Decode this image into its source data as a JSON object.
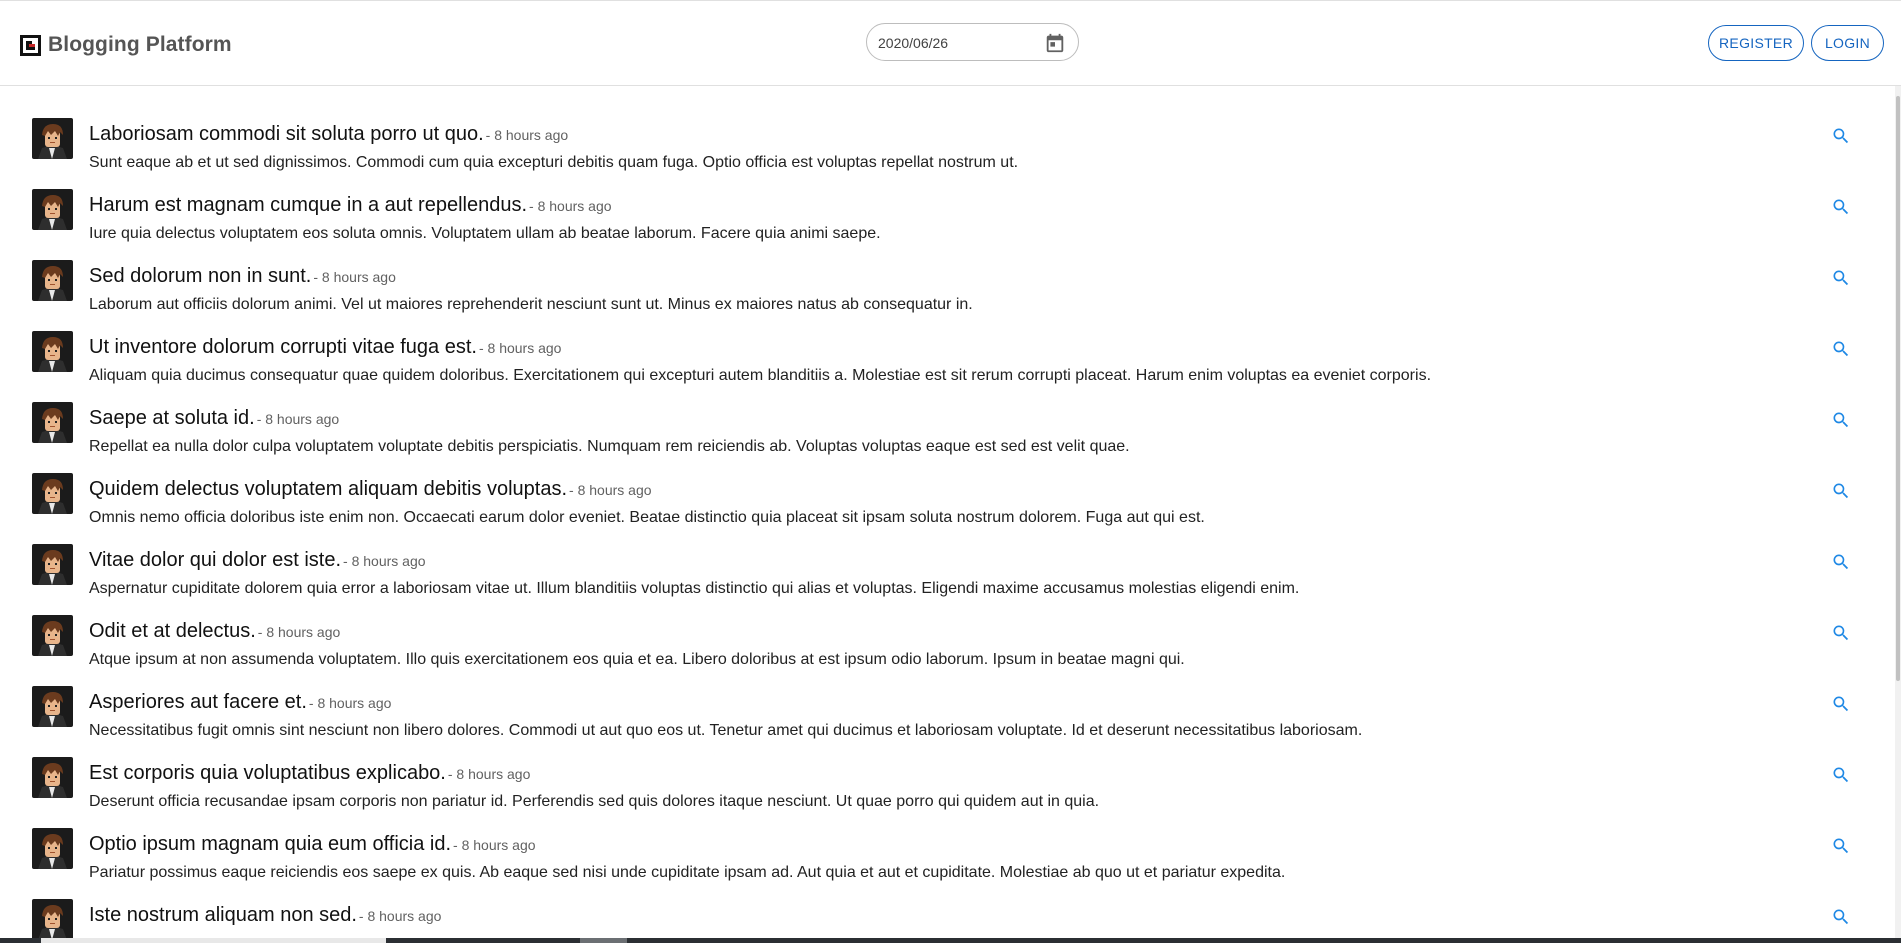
{
  "header": {
    "app_title": "Blogging Platform",
    "logo_icon": "blog-logo-icon",
    "date_value": "2020/06/26",
    "calendar_icon": "calendar-icon",
    "register_label": "REGISTER",
    "login_label": "LOGIN",
    "accent_color": "#1565c0"
  },
  "posts": [
    {
      "title": "Laboriosam commodi sit soluta porro ut quo.",
      "time": "- 8 hours ago",
      "body": "Sunt eaque ab et ut sed dignissimos. Commodi cum quia excepturi debitis quam fuga. Optio officia est voluptas repellat nostrum ut."
    },
    {
      "title": "Harum est magnam cumque in a aut repellendus.",
      "time": "- 8 hours ago",
      "body": "Iure quia delectus voluptatem eos soluta omnis. Voluptatem ullam ab beatae laborum. Facere quia animi saepe."
    },
    {
      "title": "Sed dolorum non in sunt.",
      "time": "- 8 hours ago",
      "body": "Laborum aut officiis dolorum animi. Vel ut maiores reprehenderit nesciunt sunt ut. Minus ex maiores natus ab consequatur in."
    },
    {
      "title": "Ut inventore dolorum corrupti vitae fuga est.",
      "time": "- 8 hours ago",
      "body": "Aliquam quia ducimus consequatur quae quidem doloribus. Exercitationem qui excepturi autem blanditiis a. Molestiae est sit rerum corrupti placeat. Harum enim voluptas ea eveniet corporis."
    },
    {
      "title": "Saepe at soluta id.",
      "time": "- 8 hours ago",
      "body": "Repellat ea nulla dolor culpa voluptatem voluptate debitis perspiciatis. Numquam rem reiciendis ab. Voluptas voluptas eaque est sed est velit quae."
    },
    {
      "title": "Quidem delectus voluptatem aliquam debitis voluptas.",
      "time": "- 8 hours ago",
      "body": "Omnis nemo officia doloribus iste enim non. Occaecati earum dolor eveniet. Beatae distinctio quia placeat sit ipsam soluta nostrum dolorem. Fuga aut qui est."
    },
    {
      "title": "Vitae dolor qui dolor est iste.",
      "time": "- 8 hours ago",
      "body": "Aspernatur cupiditate dolorem quia error a laboriosam vitae ut. Illum blanditiis voluptas distinctio qui alias et voluptas. Eligendi maxime accusamus molestias eligendi enim."
    },
    {
      "title": "Odit et at delectus.",
      "time": "- 8 hours ago",
      "body": "Atque ipsum at non assumenda voluptatem. Illo quis exercitationem eos quia et ea. Libero doloribus at est ipsum odio laborum. Ipsum in beatae magni qui."
    },
    {
      "title": "Asperiores aut facere et.",
      "time": "- 8 hours ago",
      "body": "Necessitatibus fugit omnis sint nesciunt non libero dolores. Commodi ut aut quo eos ut. Tenetur amet qui ducimus et laboriosam voluptate. Id et deserunt necessitatibus laboriosam."
    },
    {
      "title": "Est corporis quia voluptatibus explicabo.",
      "time": "- 8 hours ago",
      "body": "Deserunt officia recusandae ipsam corporis non pariatur id. Perferendis sed quis dolores itaque nesciunt. Ut quae porro qui quidem aut in quia."
    },
    {
      "title": "Optio ipsum magnam quia eum officia id.",
      "time": "- 8 hours ago",
      "body": "Pariatur possimus eaque reiciendis eos saepe ex quis. Ab eaque sed nisi unde cupiditate ipsam ad. Aut quia et aut et cupiditate. Molestiae ab quo ut et pariatur expedita."
    },
    {
      "title": "Iste nostrum aliquam non sed.",
      "time": "- 8 hours ago",
      "body": ""
    }
  ],
  "post_icons": {
    "avatar": "avatar",
    "action": "search-icon"
  }
}
